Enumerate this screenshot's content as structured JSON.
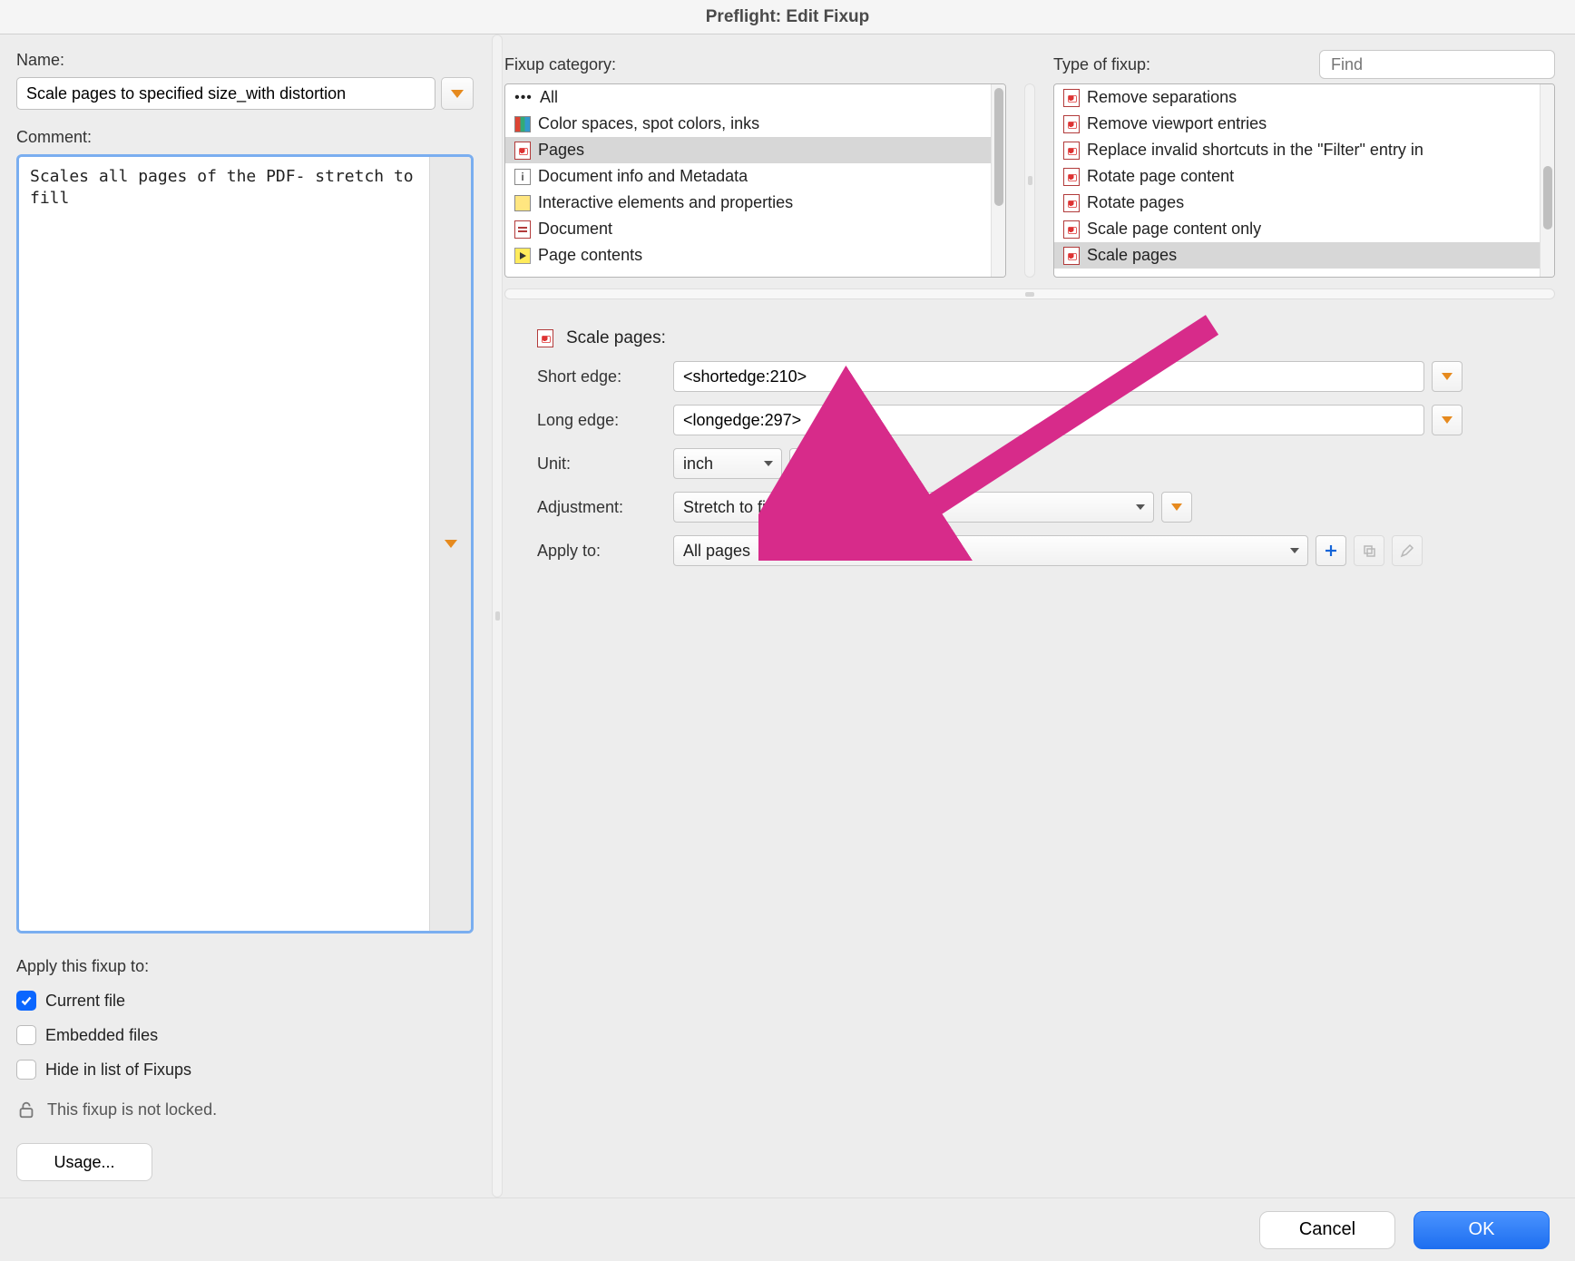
{
  "title": "Preflight: Edit Fixup",
  "left": {
    "name_label": "Name:",
    "name_value": "Scale pages to specified size_with distortion",
    "comment_label": "Comment:",
    "comment_value": "Scales all pages of the PDF- stretch to fill",
    "apply_label": "Apply this fixup to:",
    "current_file": "Current file",
    "embedded_files": "Embedded files",
    "hide_in_list": "Hide in list of Fixups",
    "lock_msg": "This fixup is not locked.",
    "usage": "Usage..."
  },
  "category": {
    "label": "Fixup category:",
    "items": [
      {
        "icon": "dots",
        "text": "All"
      },
      {
        "icon": "bars",
        "text": "Color spaces, spot colors, inks"
      },
      {
        "icon": "pdf",
        "text": "Pages",
        "selected": true
      },
      {
        "icon": "info",
        "text": "Document info and Metadata"
      },
      {
        "icon": "stack",
        "text": "Interactive elements and properties"
      },
      {
        "icon": "doc",
        "text": "Document"
      },
      {
        "icon": "arrow",
        "text": "Page contents"
      }
    ]
  },
  "type": {
    "label": "Type of fixup:",
    "find_placeholder": "Find",
    "items": [
      {
        "text": "Remove separations"
      },
      {
        "text": "Remove viewport entries"
      },
      {
        "text": "Replace invalid shortcuts in the \"Filter\" entry in"
      },
      {
        "text": "Rotate page content"
      },
      {
        "text": "Rotate pages"
      },
      {
        "text": "Scale page content only"
      },
      {
        "text": "Scale pages",
        "selected": true
      }
    ]
  },
  "section_title": "Scale pages:",
  "form": {
    "short_edge_label": "Short edge:",
    "short_edge_value": "<shortedge:210>",
    "long_edge_label": "Long edge:",
    "long_edge_value": "<longedge:297>",
    "unit_label": "Unit:",
    "unit_value": "inch",
    "adjustment_label": "Adjustment:",
    "adjustment_value": "Stretch to fill",
    "apply_to_label": "Apply to:",
    "apply_to_value": "All pages"
  },
  "footer": {
    "cancel": "Cancel",
    "ok": "OK"
  }
}
